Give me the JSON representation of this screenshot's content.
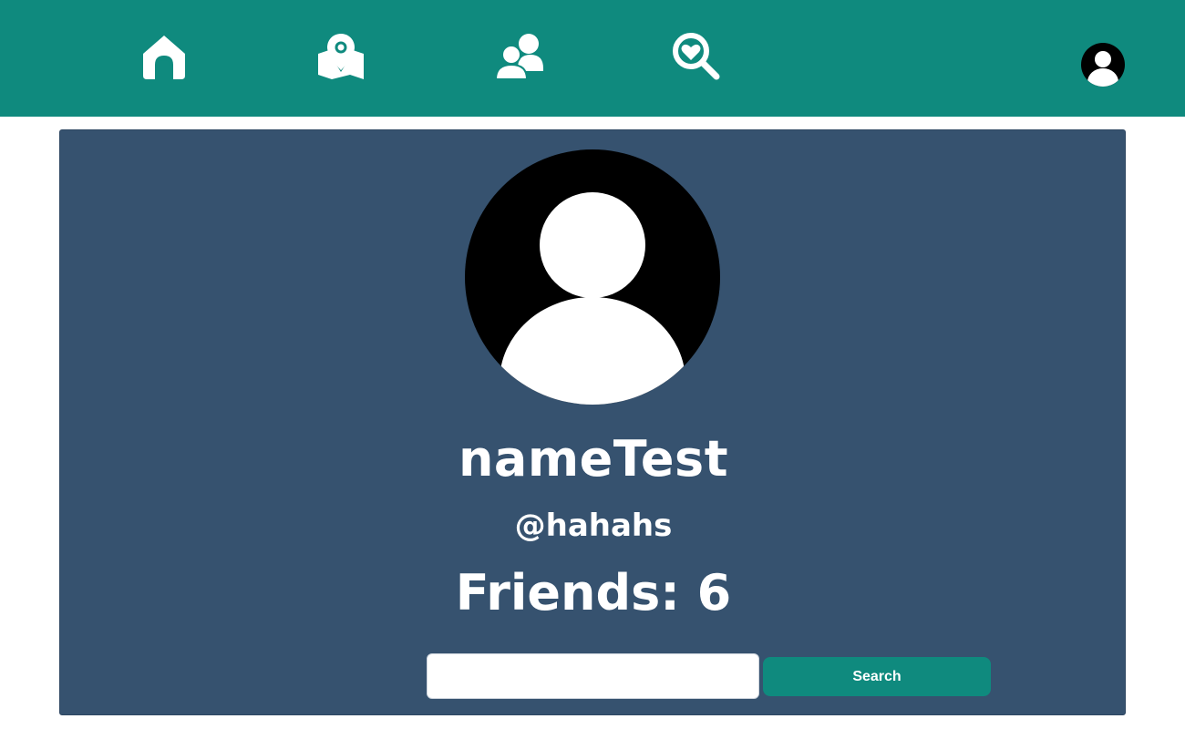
{
  "nav": {
    "items": [
      {
        "name": "home",
        "icon": "home-icon"
      },
      {
        "name": "map",
        "icon": "map-pin-icon"
      },
      {
        "name": "friends",
        "icon": "users-icon"
      },
      {
        "name": "search-favorites",
        "icon": "heart-search-icon"
      }
    ],
    "account_icon": "user-avatar-icon"
  },
  "profile": {
    "display_name": "nameTest",
    "username": "@hahahs",
    "friends_text": "Friends: 6",
    "avatar_icon": "user-avatar-icon"
  },
  "search": {
    "value": "",
    "placeholder": "",
    "button_label": "Search"
  },
  "colors": {
    "topbar": "#0f8a7e",
    "panel": "#36526f",
    "button": "#0f8a7e",
    "text": "#ffffff"
  }
}
